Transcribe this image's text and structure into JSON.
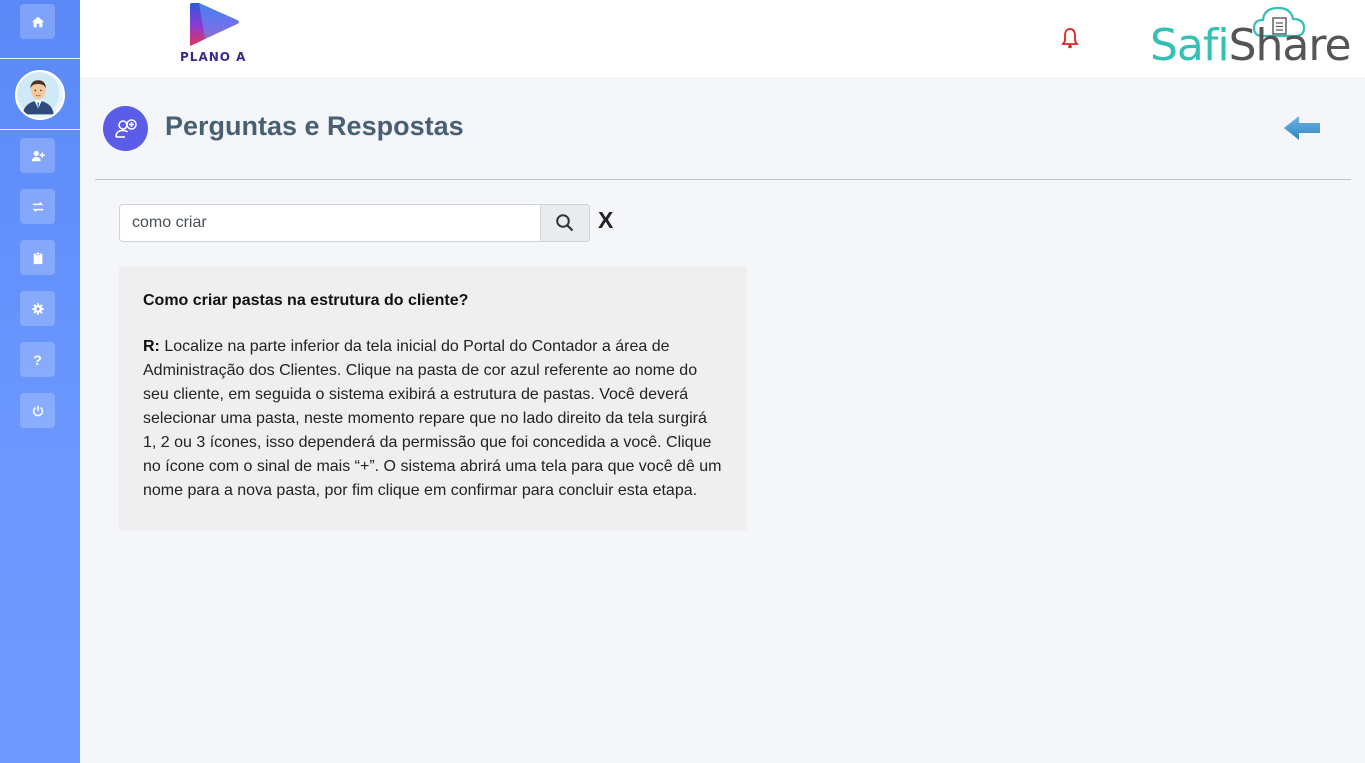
{
  "sidebar": {
    "items": [
      {
        "icon": "home-icon"
      },
      {
        "icon": "user-plus-icon"
      },
      {
        "icon": "exchange-icon"
      },
      {
        "icon": "clipboard-icon"
      },
      {
        "icon": "gear-icon"
      },
      {
        "icon": "question-icon",
        "glyph": "?"
      },
      {
        "icon": "power-icon"
      }
    ],
    "avatar": "avatar"
  },
  "header": {
    "left_logo_text": "PLANO A",
    "brand_part1": "Safi",
    "brand_part2": "Share",
    "notification_icon": "bell-icon"
  },
  "page": {
    "title": "Perguntas e Respostas",
    "title_icon": "user-add-circle-icon",
    "back_icon": "back-arrow-icon"
  },
  "search": {
    "value": "como criar",
    "button_icon": "search-icon",
    "clear_label": "X"
  },
  "result": {
    "question": "Como criar pastas na estrutura do cliente?",
    "answer_prefix": "R:",
    "answer": " Localize na parte inferior da tela inicial do Portal do Contador a área de Administração dos Clientes. Clique na pasta de cor azul referente ao nome do seu cliente, em seguida o sistema exibirá a estrutura de pastas. Você deverá selecionar uma pasta, neste momento repare que no lado direito da tela surgirá 1, 2 ou 3 ícones, isso dependerá da permissão que foi concedida a você. Clique no ícone com o sinal de mais “+”. O sistema abrirá uma tela para que você dê um nome para a nova pasta, por fim clique em confirmar para concluir esta etapa."
  },
  "colors": {
    "sidebar": "#6b97ff",
    "accent": "#5b5ce8",
    "title": "#486073",
    "brand_teal": "#35c0b4",
    "bell": "#e02020"
  }
}
